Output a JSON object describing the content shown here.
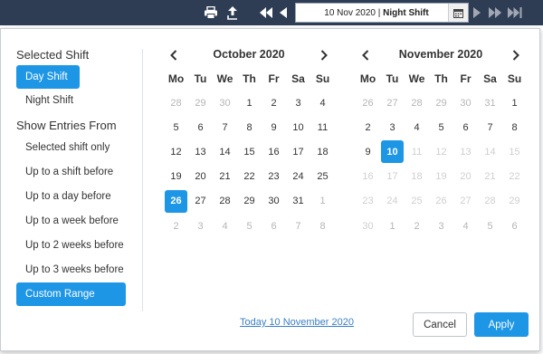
{
  "toolbar": {
    "date_value": "10 Nov 2020",
    "separator": "|",
    "shift_value": "Night Shift",
    "icons": [
      "print-icon",
      "export-icon",
      "first-icon",
      "previous-icon",
      "calendar-icon",
      "next-icon",
      "fast-forward-icon",
      "last-icon"
    ]
  },
  "left": {
    "selected_shift_title": "Selected Shift",
    "shifts": [
      {
        "label": "Day Shift",
        "selected": true
      },
      {
        "label": "Night Shift",
        "selected": false
      }
    ],
    "show_entries_title": "Show Entries From",
    "entries": [
      {
        "label": "Selected shift only",
        "selected": false
      },
      {
        "label": "Up to a shift before",
        "selected": false
      },
      {
        "label": "Up to a day before",
        "selected": false
      },
      {
        "label": "Up to a week before",
        "selected": false
      },
      {
        "label": "Up to 2 weeks before",
        "selected": false
      },
      {
        "label": "Up to 3 weeks before",
        "selected": false
      },
      {
        "label": "Custom Range",
        "selected": true
      }
    ]
  },
  "calendars": [
    {
      "title": "October 2020",
      "weekdays": [
        "Mo",
        "Tu",
        "We",
        "Th",
        "Fr",
        "Sa",
        "Su"
      ],
      "weeks": [
        [
          "28",
          "29",
          "30",
          "1",
          "2",
          "3",
          "4"
        ],
        [
          "5",
          "6",
          "7",
          "8",
          "9",
          "10",
          "11"
        ],
        [
          "12",
          "13",
          "14",
          "15",
          "16",
          "17",
          "18"
        ],
        [
          "19",
          "20",
          "21",
          "22",
          "23",
          "24",
          "25"
        ],
        [
          "26",
          "27",
          "28",
          "29",
          "30",
          "31",
          "1"
        ],
        [
          "2",
          "3",
          "4",
          "5",
          "6",
          "7",
          "8"
        ]
      ],
      "selected": "26"
    },
    {
      "title": "November 2020",
      "weekdays": [
        "Mo",
        "Tu",
        "We",
        "Th",
        "Fr",
        "Sa",
        "Su"
      ],
      "weeks": [
        [
          "26",
          "27",
          "28",
          "29",
          "30",
          "31",
          "1"
        ],
        [
          "2",
          "3",
          "4",
          "5",
          "6",
          "7",
          "8"
        ],
        [
          "9",
          "10",
          "11",
          "12",
          "13",
          "14",
          "15"
        ],
        [
          "16",
          "17",
          "18",
          "19",
          "20",
          "21",
          "22"
        ],
        [
          "23",
          "24",
          "25",
          "26",
          "27",
          "28",
          "29"
        ],
        [
          "30",
          "1",
          "2",
          "3",
          "4",
          "5",
          "6"
        ]
      ],
      "selected": "10"
    }
  ],
  "footer": {
    "today_label": "Today 10 November 2020",
    "cancel_label": "Cancel",
    "apply_label": "Apply"
  },
  "colors": {
    "toolbar_bg": "#2e3d54",
    "accent": "#1e96e6",
    "link": "#3b7fc4"
  }
}
